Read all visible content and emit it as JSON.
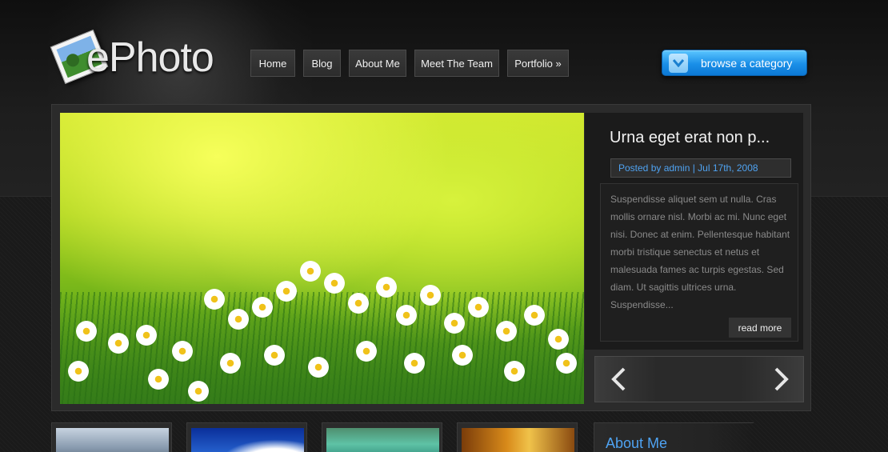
{
  "brand": {
    "logo_text": "ePhoto"
  },
  "nav": {
    "items": [
      {
        "label": "Home"
      },
      {
        "label": "Blog"
      },
      {
        "label": "About Me"
      },
      {
        "label": "Meet The Team"
      },
      {
        "label": "Portfolio »"
      }
    ]
  },
  "browse_button": {
    "label": "browse a category"
  },
  "feature": {
    "title": "Urna eget erat non p...",
    "meta": "Posted by admin | Jul 17th, 2008",
    "excerpt": "Suspendisse aliquet sem ut nulla. Cras mollis ornare nisl. Morbi ac mi. Nunc eget nisi. Donec at enim. Pellentesque habitant morbi tristique senectus et netus et malesuada fames ac turpis egestas. Sed diam. Ut sagittis ultrices urna. Suspendisse...",
    "read_more": "read more"
  },
  "sidebar": {
    "about_title": "About Me"
  },
  "colors": {
    "accent_blue": "#4fa3f2",
    "button_blue": "#1a8fe8",
    "background": "#141414"
  }
}
